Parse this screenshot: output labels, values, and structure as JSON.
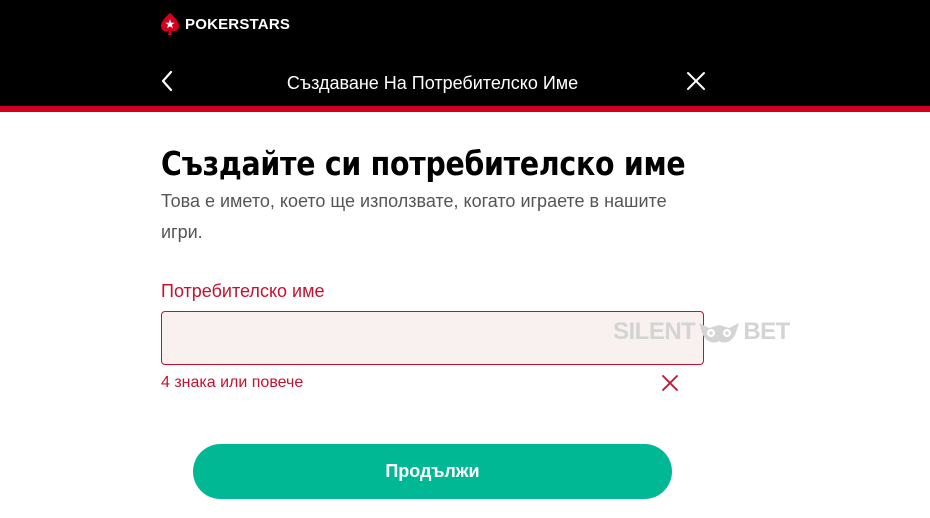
{
  "brand": {
    "logo_text": "POKERSTARS",
    "logo_icon": "spade-star-icon"
  },
  "header": {
    "back_icon": "chevron-left-icon",
    "title": "Създаване На Потребителско Име",
    "close_icon": "close-icon"
  },
  "main": {
    "heading": "Създайте си потребителско име",
    "subtext": "Това е името, което ще използвате, когато играете в нашите игри.",
    "field": {
      "label": "Потребителско име",
      "value": "",
      "placeholder": "",
      "error": "4 знака или повече",
      "error_icon": "x-mark-icon"
    },
    "continue_label": "Продължи"
  },
  "watermark": {
    "left": "SILENT",
    "right": "BET",
    "icon": "owl-icon"
  },
  "colors": {
    "header_bg": "#000000",
    "accent_red": "#d2001e",
    "error_red": "#c8102e",
    "button_green": "#00b894",
    "input_bg": "#f9f0f0"
  }
}
